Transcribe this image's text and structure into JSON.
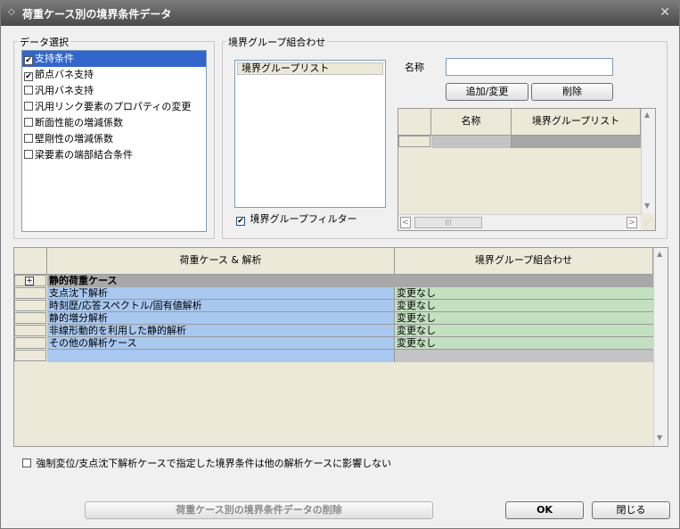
{
  "window": {
    "title": "荷重ケース別の境界条件データ"
  },
  "data_selection": {
    "label": "データ選択",
    "items": [
      {
        "label": "支持条件",
        "checked": true,
        "selected": true
      },
      {
        "label": "節点バネ支持",
        "checked": true,
        "selected": false
      },
      {
        "label": "汎用バネ支持",
        "checked": false,
        "selected": false
      },
      {
        "label": "汎用リンク要素のプロパティの変更",
        "checked": false,
        "selected": false
      },
      {
        "label": "断面性能の増減係数",
        "checked": false,
        "selected": false
      },
      {
        "label": "壁剛性の増減係数",
        "checked": false,
        "selected": false
      },
      {
        "label": "梁要素の端部結合条件",
        "checked": false,
        "selected": false
      }
    ]
  },
  "boundary_combo": {
    "label": "境界グループ組合わせ",
    "list_header": "境界グループリスト",
    "filter_label": "境界グループフィルター",
    "filter_checked": true,
    "name_label": "名称",
    "name_value": "",
    "add_button": "追加/変更",
    "delete_button": "削除",
    "table_headers": [
      "名称",
      "境界グループリスト"
    ]
  },
  "load_grid": {
    "headers": [
      "荷重ケース & 解析",
      "境界グループ組合わせ"
    ],
    "group_label": "静的荷重ケース",
    "expand_symbol": "+",
    "rows": [
      {
        "case": "支点沈下解析",
        "combo": "変更なし"
      },
      {
        "case": "時刻歴/応答スペクトル/固有値解析",
        "combo": "変更なし"
      },
      {
        "case": "静的増分解析",
        "combo": "変更なし"
      },
      {
        "case": "非線形動的を利用した静的解析",
        "combo": "変更なし"
      },
      {
        "case": "その他の解析ケース",
        "combo": "変更なし"
      }
    ]
  },
  "footer": {
    "option_label": "強制変位/支点沈下解析ケースで指定した境界条件は他の解析ケースに影響しない",
    "option_checked": false,
    "delete_all_button": "荷重ケース別の境界条件データの削除",
    "ok_button": "OK",
    "close_button": "閉じる"
  },
  "icons": {
    "title": "collapse-icon",
    "close": "close-icon"
  }
}
